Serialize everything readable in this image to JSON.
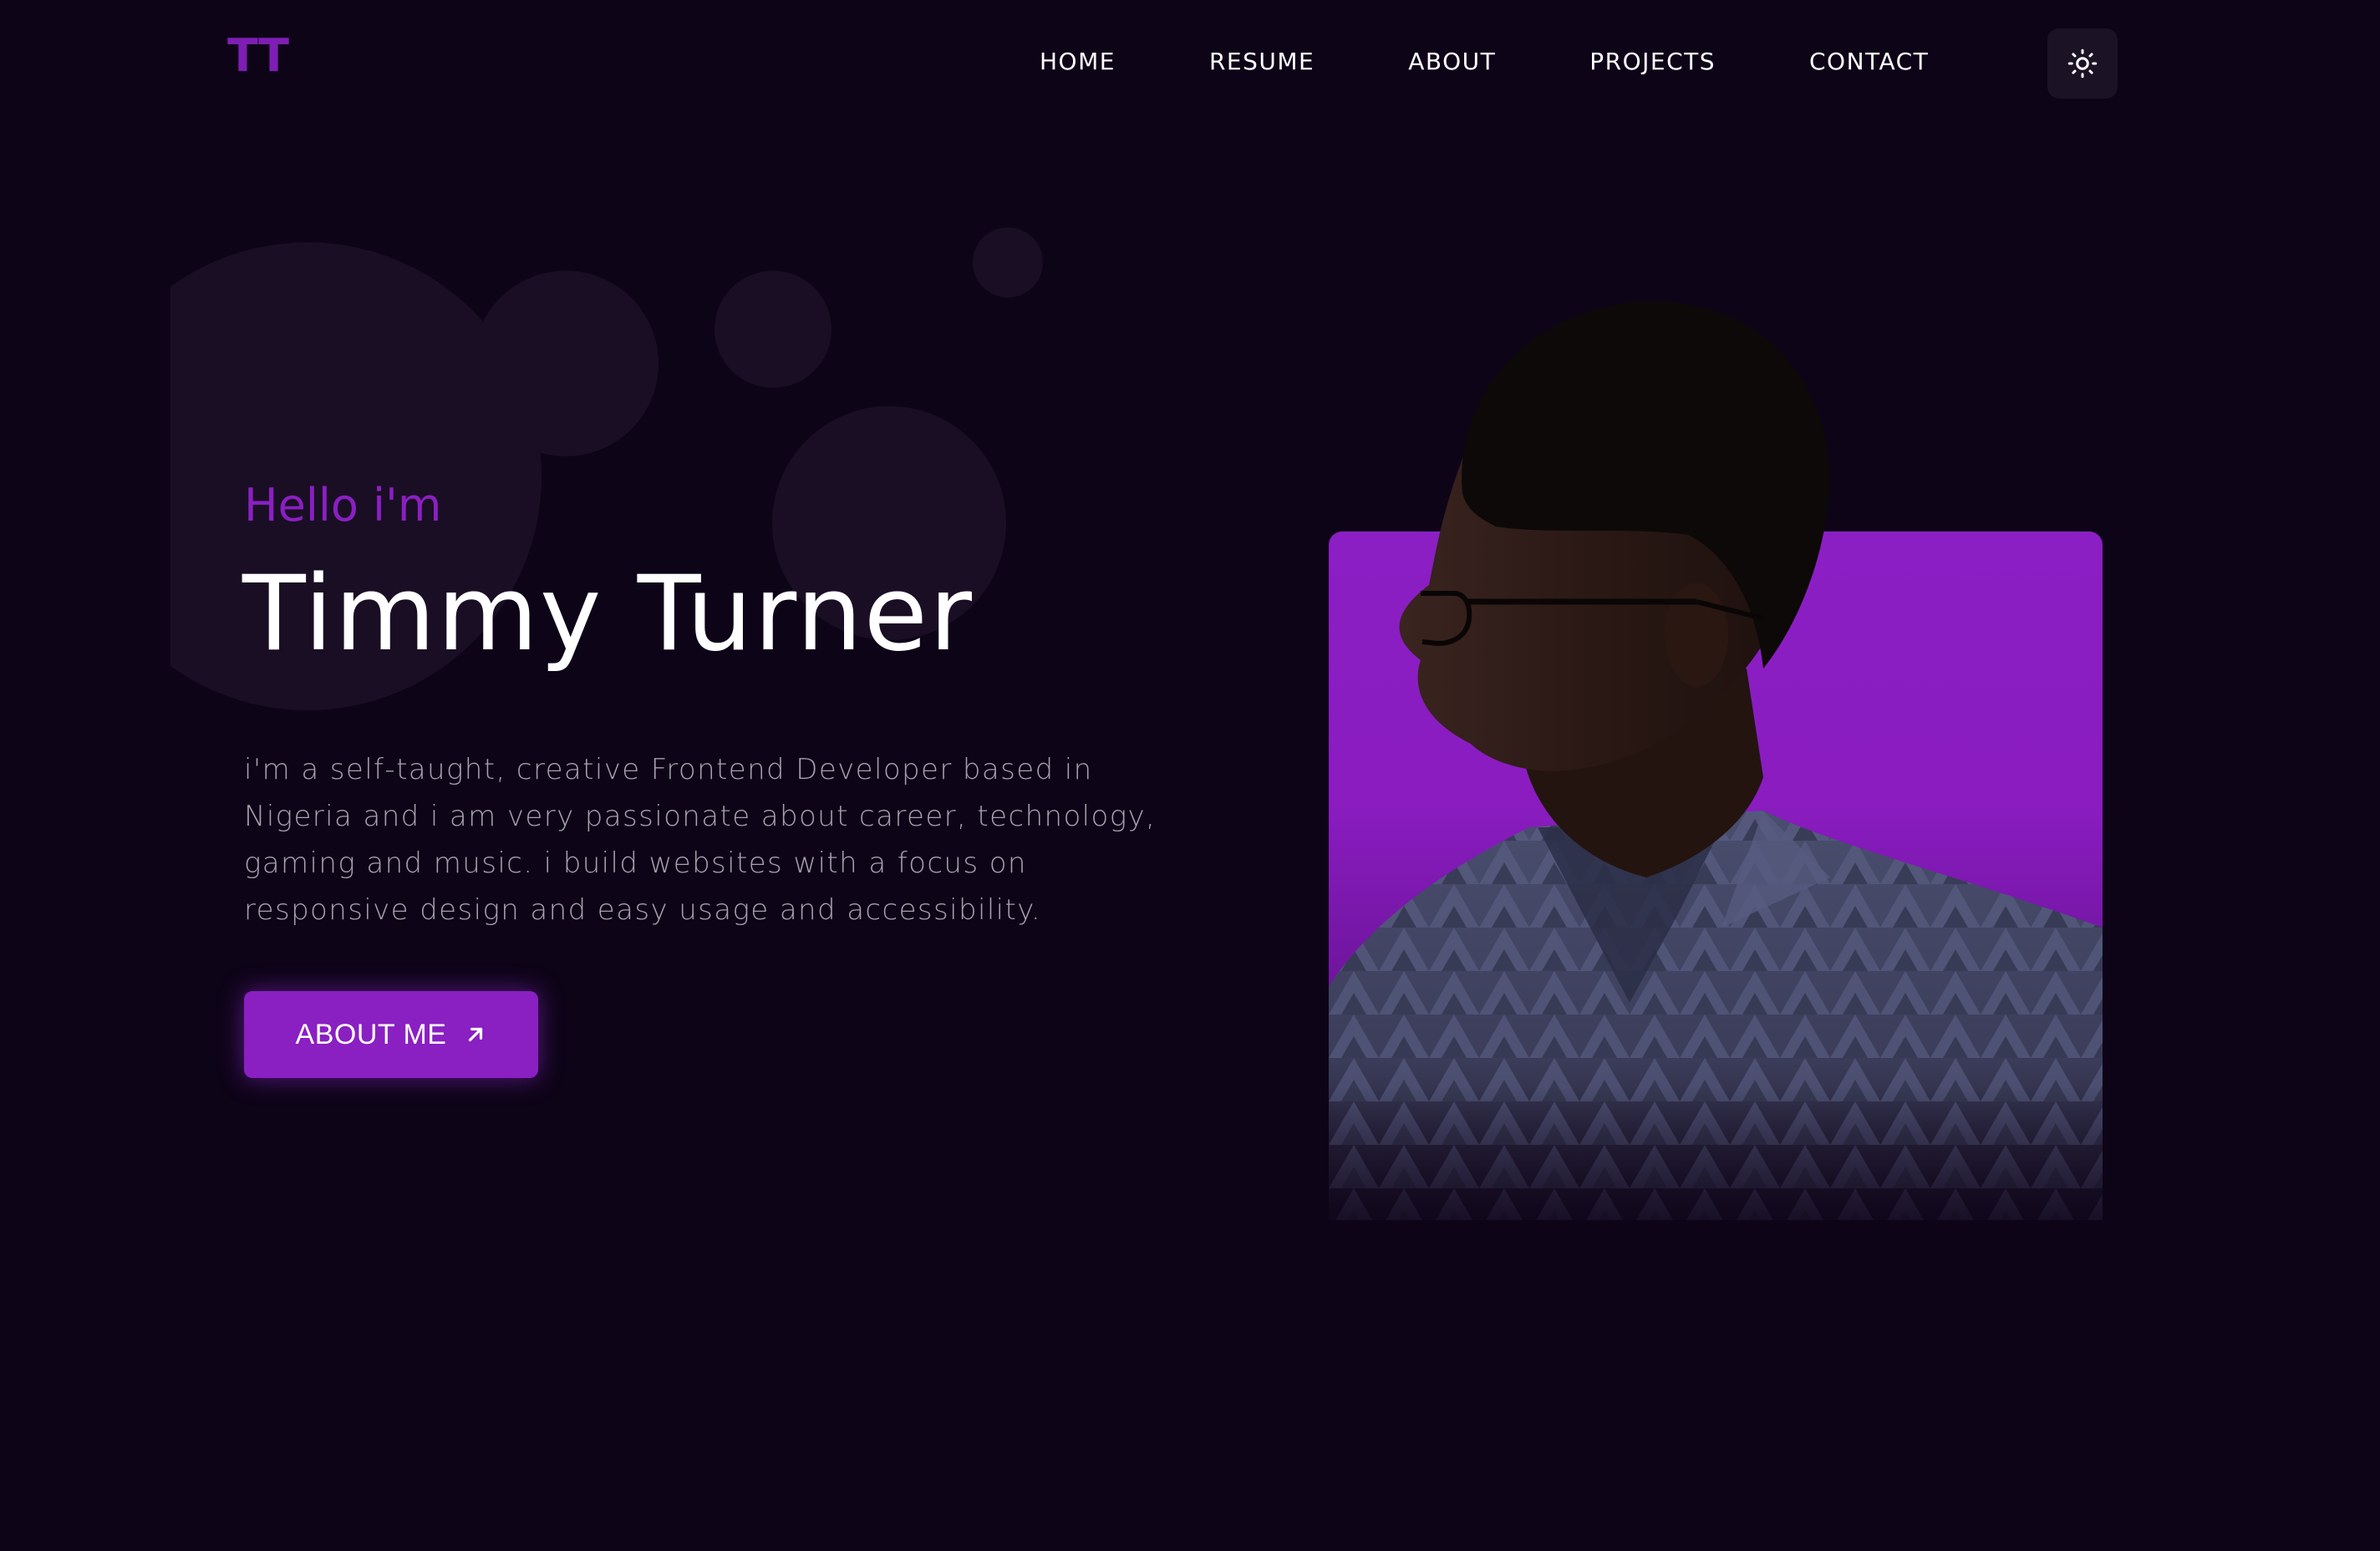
{
  "brand": {
    "logo_text": "TT"
  },
  "nav": {
    "items": [
      {
        "label": "HOME"
      },
      {
        "label": "RESUME"
      },
      {
        "label": "ABOUT"
      },
      {
        "label": "PROJECTS"
      },
      {
        "label": "CONTACT"
      }
    ],
    "theme_toggle_icon": "sun-icon"
  },
  "hero": {
    "greeting": "Hello i'm",
    "name": "Timmy Turner",
    "bio": "i'm a self-taught, creative Frontend Developer based in Nigeria and i am very passionate about career, technology, gaming and music. i build websites with a focus on responsive design and easy usage and accessibility.",
    "cta_label": "ABOUT ME",
    "cta_icon": "arrow-up-right-icon"
  },
  "colors": {
    "background": "#0e0418",
    "accent": "#8a1fc2",
    "text": "#ffffff",
    "muted_text": "#a7a2ae"
  }
}
